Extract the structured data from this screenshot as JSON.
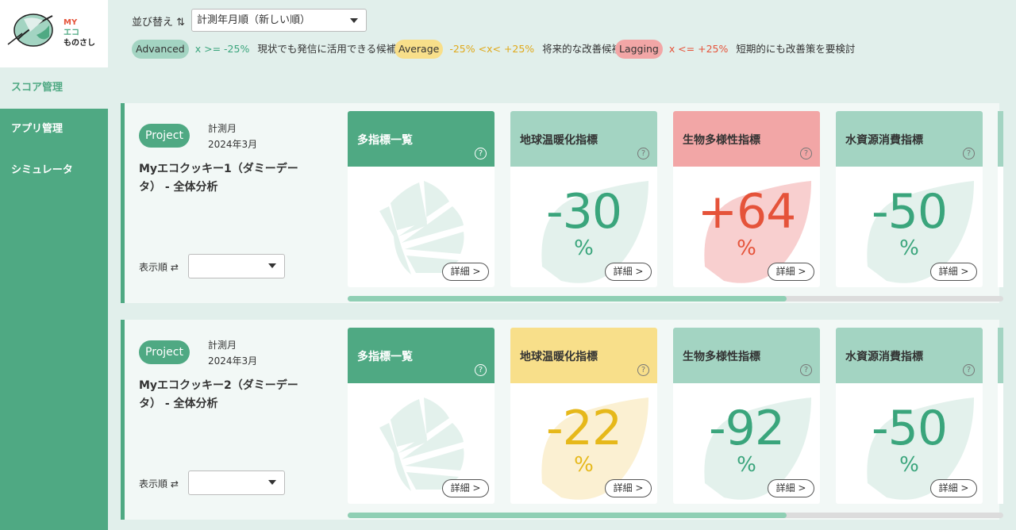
{
  "logo": {
    "line1": "MY",
    "line2": "エコ",
    "line3": "ものさし"
  },
  "sidebar": {
    "items": [
      {
        "label": "スコア管理",
        "active": true
      },
      {
        "label": "アプリ管理",
        "active": false
      },
      {
        "label": "シミュレータ",
        "active": false
      }
    ]
  },
  "toolbar": {
    "sort_label": "並び替え ⇅",
    "sort_value": "計測年月順（新しい順）"
  },
  "legend": [
    {
      "badge": "Advanced",
      "range": "x >= -25%",
      "desc": "現状でも発信に活用できる候補",
      "badge_color": "#a3d4c2",
      "range_color": "#3aa57c"
    },
    {
      "badge": "Average",
      "range": "-25% <x< +25%",
      "desc": "将来的な改善候補",
      "badge_color": "#f8df8a",
      "range_color": "#e0a91a"
    },
    {
      "badge": "Lagging",
      "range": "x <= +25%",
      "desc": "短期的にも改善策を要検討",
      "badge_color": "#f2a6a6",
      "range_color": "#e5533a"
    }
  ],
  "projects": [
    {
      "badge": "Project",
      "measure_label": "計測月",
      "measure_value": "2024年3月",
      "name": "Myエコクッキー1（ダミーデータ） - 全体分析",
      "order_label": "表示順 ⇄",
      "scroll_fraction": 0.67,
      "cards": [
        {
          "title": "多指標一覧",
          "help": "?",
          "value": "",
          "unit": "",
          "type": "overview",
          "head_color": "#4fa983",
          "head_text": "#ffffff"
        },
        {
          "title": "地球温暖化指標",
          "help": "?",
          "value": "-30",
          "unit": "%",
          "type": "leaf",
          "head_color": "#a3d4c2",
          "head_text": "#333333",
          "value_color": "#3aa57c",
          "leaf_color": "#e3f1ec",
          "detail": "詳細 >"
        },
        {
          "title": "生物多様性指標",
          "help": "?",
          "value": "+64",
          "unit": "%",
          "type": "leaf",
          "head_color": "#f2a6a6",
          "head_text": "#333333",
          "value_color": "#e5533a",
          "leaf_color": "#f8cfcf",
          "detail": "詳細 >"
        },
        {
          "title": "水資源消費指標",
          "help": "?",
          "value": "-50",
          "unit": "%",
          "type": "leaf",
          "head_color": "#a3d4c2",
          "head_text": "#333333",
          "value_color": "#3aa57c",
          "leaf_color": "#e3f1ec",
          "detail": "詳細 >"
        }
      ],
      "overview_detail": "詳細 >"
    },
    {
      "badge": "Project",
      "measure_label": "計測月",
      "measure_value": "2024年3月",
      "name": "Myエコクッキー2（ダミーデータ） - 全体分析",
      "order_label": "表示順 ⇄",
      "scroll_fraction": 0.67,
      "cards": [
        {
          "title": "多指標一覧",
          "help": "?",
          "value": "",
          "unit": "",
          "type": "overview",
          "head_color": "#4fa983",
          "head_text": "#ffffff"
        },
        {
          "title": "地球温暖化指標",
          "help": "?",
          "value": "-22",
          "unit": "%",
          "type": "leaf",
          "head_color": "#f8df8a",
          "head_text": "#333333",
          "value_color": "#e6b81a",
          "leaf_color": "#fbf0d2",
          "detail": "詳細 >"
        },
        {
          "title": "生物多様性指標",
          "help": "?",
          "value": "-92",
          "unit": "%",
          "type": "leaf",
          "head_color": "#a3d4c2",
          "head_text": "#333333",
          "value_color": "#3aa57c",
          "leaf_color": "#e3f1ec",
          "detail": "詳細 >"
        },
        {
          "title": "水資源消費指標",
          "help": "?",
          "value": "-50",
          "unit": "%",
          "type": "leaf",
          "head_color": "#a3d4c2",
          "head_text": "#333333",
          "value_color": "#3aa57c",
          "leaf_color": "#e3f1ec",
          "detail": "詳細 >"
        }
      ],
      "overview_detail": "詳細 >"
    }
  ]
}
